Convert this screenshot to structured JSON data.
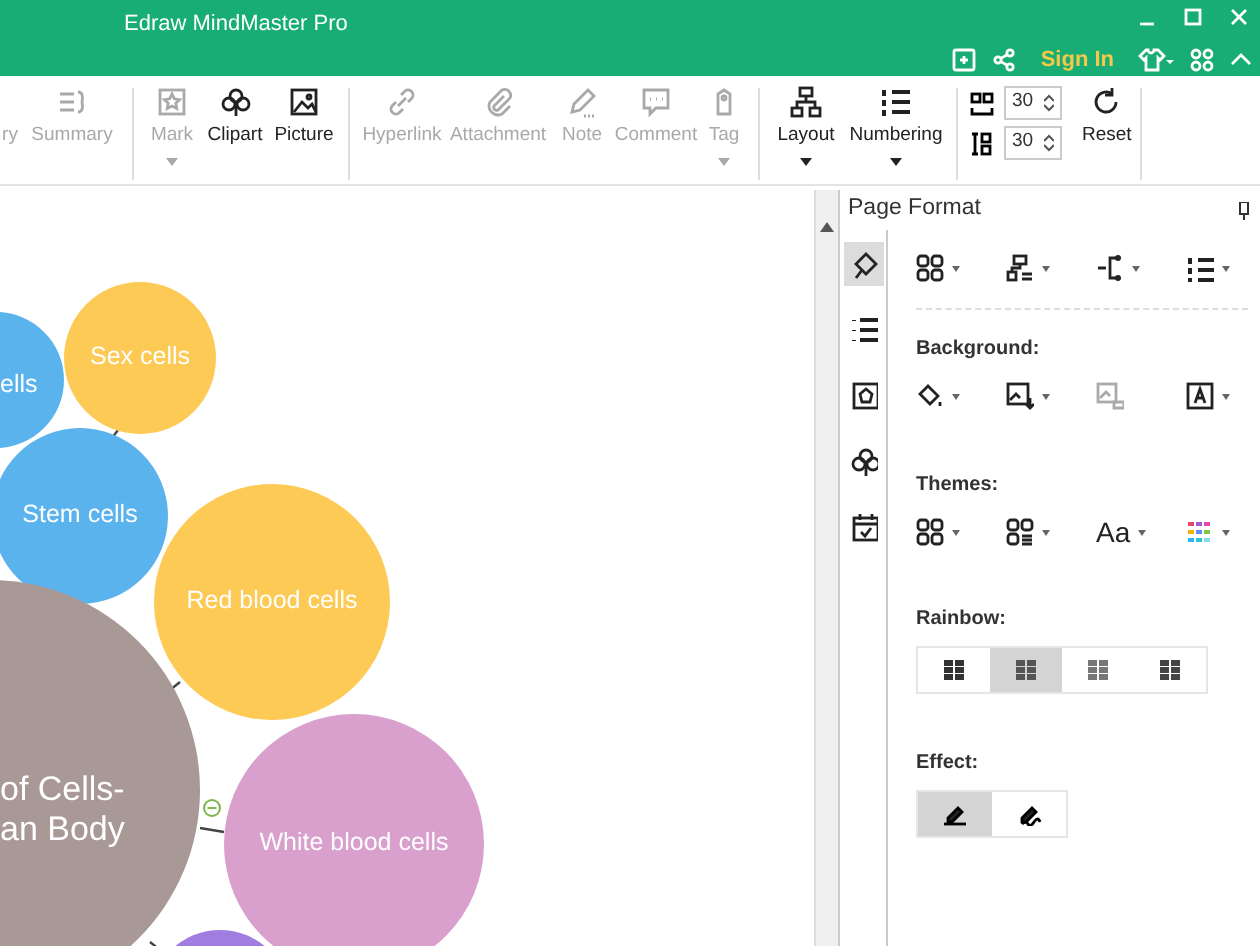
{
  "window": {
    "title": "Edraw MindMaster Pro"
  },
  "header": {
    "sign_in": "Sign In"
  },
  "ribbon": {
    "items": [
      {
        "label": "ry",
        "disabled": true,
        "has_menu": false
      },
      {
        "label": "Summary",
        "disabled": true,
        "has_menu": false
      },
      {
        "label": "Mark",
        "disabled": true,
        "has_menu": true
      },
      {
        "label": "Clipart",
        "disabled": false,
        "has_menu": false
      },
      {
        "label": "Picture",
        "disabled": false,
        "has_menu": false
      },
      {
        "label": "Hyperlink",
        "disabled": true,
        "has_menu": false
      },
      {
        "label": "Attachment",
        "disabled": true,
        "has_menu": false
      },
      {
        "label": "Note",
        "disabled": true,
        "has_menu": false
      },
      {
        "label": "Comment",
        "disabled": true,
        "has_menu": false
      },
      {
        "label": "Tag",
        "disabled": true,
        "has_menu": true
      },
      {
        "label": "Layout",
        "disabled": false,
        "has_menu": true
      },
      {
        "label": "Numbering",
        "disabled": false,
        "has_menu": true
      }
    ],
    "spacing": {
      "horizontal": "30",
      "vertical": "30"
    },
    "reset": "Reset"
  },
  "mindmap": {
    "nodes": [
      {
        "text": "ells",
        "color": "#5bb3ee"
      },
      {
        "text": "Sex cells",
        "color": "#fdca55"
      },
      {
        "text": "Stem cells",
        "color": "#5bb3ee"
      },
      {
        "text": "Red blood cells",
        "color": "#fdca55"
      },
      {
        "text": "of Cells-\nan Body",
        "color": "#a89896"
      },
      {
        "text": "White blood cells",
        "color": "#d9a0cd"
      },
      {
        "color": "#a07de0"
      }
    ]
  },
  "panel": {
    "title": "Page Format",
    "side_tabs": [
      {
        "selected": true
      },
      {
        "selected": false
      },
      {
        "selected": false
      },
      {
        "selected": false
      },
      {
        "selected": false
      }
    ],
    "layout_tools": [
      {
        "disabled": false
      },
      {
        "disabled": false
      },
      {
        "disabled": false
      },
      {
        "disabled": false
      }
    ],
    "background": {
      "heading": "Background:",
      "tools": [
        {
          "disabled": false
        },
        {
          "disabled": false
        },
        {
          "disabled": true
        },
        {
          "disabled": false
        }
      ]
    },
    "themes": {
      "heading": "Themes:",
      "font_sample": "Aa"
    },
    "rainbow": {
      "heading": "Rainbow:",
      "options": [
        {
          "selected": false
        },
        {
          "selected": true
        },
        {
          "selected": false
        },
        {
          "selected": false
        }
      ]
    },
    "effect": {
      "heading": "Effect:",
      "options": [
        {
          "selected": true
        },
        {
          "selected": false
        }
      ]
    }
  }
}
